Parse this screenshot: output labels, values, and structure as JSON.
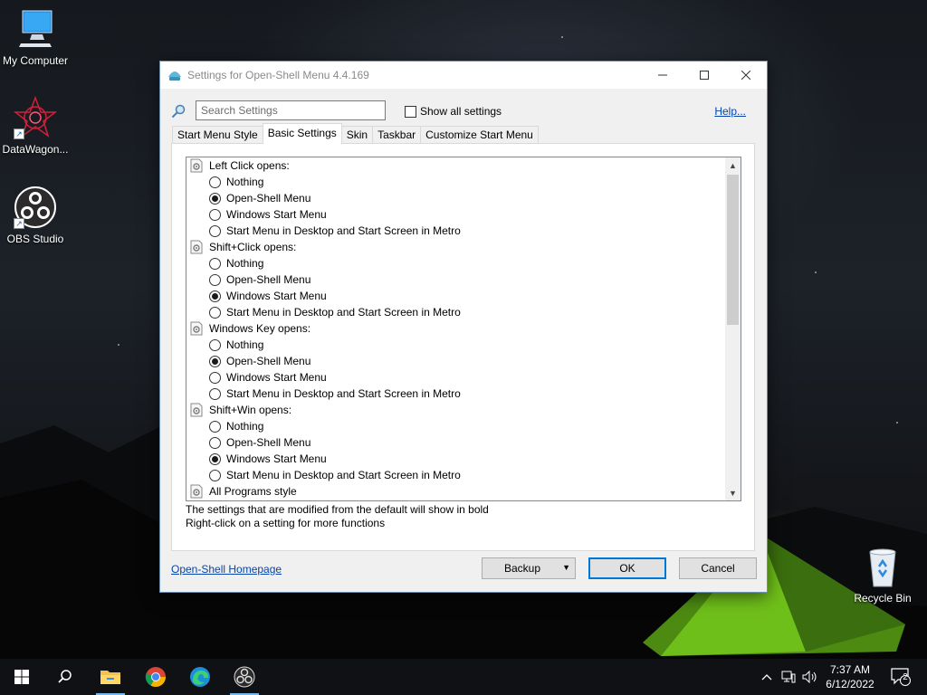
{
  "desktop": {
    "icons": [
      {
        "label": "My Computer"
      },
      {
        "label": "DataWagon..."
      },
      {
        "label": "OBS Studio"
      },
      {
        "label": "Recycle Bin"
      }
    ]
  },
  "window": {
    "title": "Settings for Open-Shell Menu 4.4.169",
    "search_placeholder": "Search Settings",
    "show_all_label": "Show all settings",
    "show_all_checked": false,
    "help_label": "Help...",
    "tabs": [
      {
        "label": "Start Menu Style",
        "active": false
      },
      {
        "label": "Basic Settings",
        "active": true
      },
      {
        "label": "Skin",
        "active": false
      },
      {
        "label": "Taskbar",
        "active": false
      },
      {
        "label": "Customize Start Menu",
        "active": false
      }
    ],
    "settings": [
      {
        "label": "Left Click opens:",
        "options": [
          {
            "label": "Nothing",
            "selected": false
          },
          {
            "label": "Open-Shell Menu",
            "selected": true
          },
          {
            "label": "Windows Start Menu",
            "selected": false
          },
          {
            "label": "Start Menu in Desktop and Start Screen in Metro",
            "selected": false
          }
        ]
      },
      {
        "label": "Shift+Click opens:",
        "options": [
          {
            "label": "Nothing",
            "selected": false
          },
          {
            "label": "Open-Shell Menu",
            "selected": false
          },
          {
            "label": "Windows Start Menu",
            "selected": true
          },
          {
            "label": "Start Menu in Desktop and Start Screen in Metro",
            "selected": false
          }
        ]
      },
      {
        "label": "Windows Key opens:",
        "options": [
          {
            "label": "Nothing",
            "selected": false
          },
          {
            "label": "Open-Shell Menu",
            "selected": true
          },
          {
            "label": "Windows Start Menu",
            "selected": false
          },
          {
            "label": "Start Menu in Desktop and Start Screen in Metro",
            "selected": false
          }
        ]
      },
      {
        "label": "Shift+Win opens:",
        "options": [
          {
            "label": "Nothing",
            "selected": false
          },
          {
            "label": "Open-Shell Menu",
            "selected": false
          },
          {
            "label": "Windows Start Menu",
            "selected": true
          },
          {
            "label": "Start Menu in Desktop and Start Screen in Metro",
            "selected": false
          }
        ]
      },
      {
        "label": "All Programs style",
        "options": []
      }
    ],
    "hint_line1": "The settings that are modified from the default will show in bold",
    "hint_line2": "Right-click on a setting for more functions",
    "homepage_label": "Open-Shell Homepage",
    "backup_label": "Backup",
    "ok_label": "OK",
    "cancel_label": "Cancel"
  },
  "taskbar": {
    "time": "7:37 AM",
    "date": "6/12/2022",
    "notification_count": "2",
    "pinned": [
      "windows-start-icon",
      "search-icon",
      "file-explorer-icon",
      "chrome-icon",
      "edge-icon",
      "obs-icon"
    ]
  },
  "colors": {
    "link": "#0645ad",
    "taskbar": "#101114",
    "focus_border": "#0078d7"
  }
}
